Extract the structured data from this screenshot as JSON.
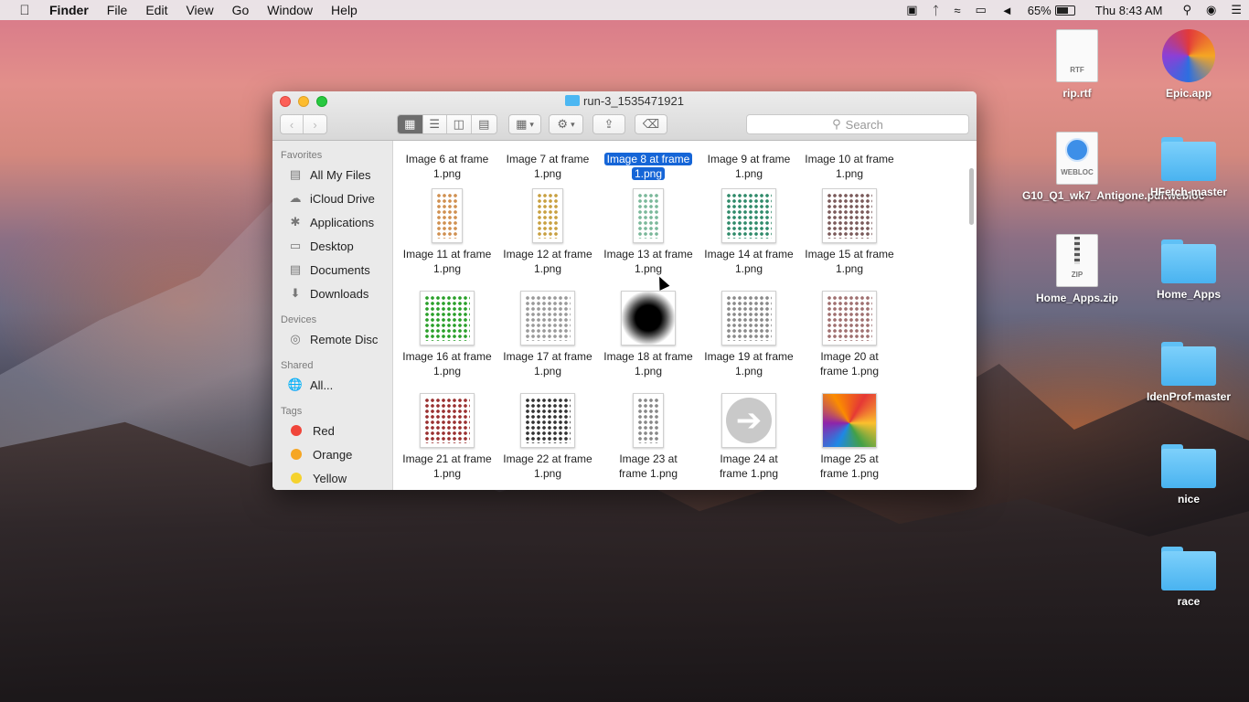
{
  "menubar": {
    "apple_icon": "apple-icon",
    "app": "Finder",
    "items": [
      "File",
      "Edit",
      "View",
      "Go",
      "Window",
      "Help"
    ],
    "battery": "65%",
    "clock": "Thu 8:43 AM"
  },
  "desktop": {
    "icons": [
      {
        "label": "rip.rtf",
        "badge": "RTF"
      },
      {
        "label": "Epic.app"
      },
      {
        "label": "G10_Q1_wk7_Antigone.pdf.webloc",
        "badge": "WEBLOC"
      },
      {
        "label": "HFetch-master"
      },
      {
        "label": "Home_Apps.zip",
        "badge": "ZIP"
      },
      {
        "label": "Home_Apps"
      },
      {
        "label": "IdenProf-master"
      },
      {
        "label": "nice"
      },
      {
        "label": "race"
      }
    ]
  },
  "window": {
    "title": "run-3_1535471921",
    "search_placeholder": "Search"
  },
  "sidebar": {
    "favorites_header": "Favorites",
    "favorites": [
      "All My Files",
      "iCloud Drive",
      "Applications",
      "Desktop",
      "Documents",
      "Downloads"
    ],
    "devices_header": "Devices",
    "devices": [
      "Remote Disc"
    ],
    "shared_header": "Shared",
    "shared": [
      "All..."
    ],
    "tags_header": "Tags",
    "tags": [
      {
        "name": "Red",
        "color": "#f0453a"
      },
      {
        "name": "Orange",
        "color": "#f6a623"
      },
      {
        "name": "Yellow",
        "color": "#f5d22e"
      }
    ]
  },
  "files": [
    {
      "line1": "Image 6 at frame",
      "line2": "1.png"
    },
    {
      "line1": "Image 7 at frame",
      "line2": "1.png"
    },
    {
      "line1": "Image 8 at frame",
      "line2": "1.png",
      "selected": true
    },
    {
      "line1": "Image 9 at frame",
      "line2": "1.png"
    },
    {
      "line1": "Image 10 at frame",
      "line2": "1.png"
    },
    {
      "line1": "Image 11 at frame",
      "line2": "1.png",
      "thumb": "dots",
      "color": "#d09050",
      "narrow": true
    },
    {
      "line1": "Image 12 at frame",
      "line2": "1.png",
      "thumb": "dots",
      "color": "#c8a040",
      "narrow": true
    },
    {
      "line1": "Image 13 at frame",
      "line2": "1.png",
      "thumb": "dots",
      "color": "#7ab89a",
      "narrow": true
    },
    {
      "line1": "Image 14 at frame",
      "line2": "1.png",
      "thumb": "dots",
      "color": "#2f8a6a"
    },
    {
      "line1": "Image 15 at frame",
      "line2": "1.png",
      "thumb": "dots",
      "color": "#7a5a5a"
    },
    {
      "line1": "Image 16 at frame",
      "line2": "1.png",
      "thumb": "dots",
      "color": "#2aa02a"
    },
    {
      "line1": "Image 17 at frame",
      "line2": "1.png",
      "thumb": "dots",
      "color": "#9a9a9a"
    },
    {
      "line1": "Image 18 at frame",
      "line2": "1.png",
      "thumb": "blur"
    },
    {
      "line1": "Image 19 at frame",
      "line2": "1.png",
      "thumb": "dots",
      "color": "#8a8a8a"
    },
    {
      "line1": "Image 20 at",
      "line2": "frame 1.png",
      "thumb": "dots",
      "color": "#a07070"
    },
    {
      "line1": "Image 21 at frame",
      "line2": "1.png",
      "thumb": "dots",
      "color": "#9a3030"
    },
    {
      "line1": "Image 22 at frame",
      "line2": "1.png",
      "thumb": "dots",
      "color": "#333333"
    },
    {
      "line1": "Image 23 at",
      "line2": "frame 1.png",
      "thumb": "dots",
      "color": "#888888",
      "narrow": true
    },
    {
      "line1": "Image 24 at",
      "line2": "frame 1.png",
      "thumb": "arrow"
    },
    {
      "line1": "Image 25 at",
      "line2": "frame 1.png",
      "thumb": "colorful"
    }
  ]
}
